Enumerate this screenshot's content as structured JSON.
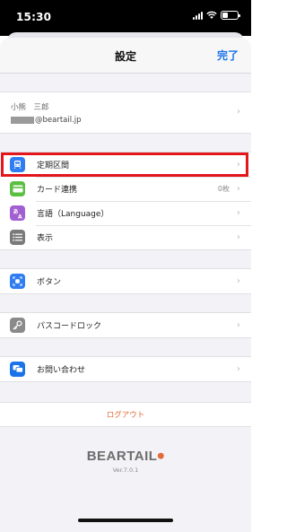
{
  "status_bar": {
    "time": "15:30",
    "battery_level": 0.35,
    "icons": [
      "signal-icon",
      "wifi-icon",
      "battery-icon"
    ]
  },
  "nav": {
    "title": "設定",
    "done_label": "完了"
  },
  "account": {
    "name": "小熊　三郎",
    "email_suffix": "@beartail.jp"
  },
  "menu": {
    "items": [
      {
        "label": "定期区間",
        "value": "",
        "icon": "train-icon",
        "color": "#2f7df0",
        "highlighted": true
      },
      {
        "label": "カード連携",
        "value": "0枚",
        "icon": "card-icon",
        "color": "#5bbf42",
        "highlighted": false
      },
      {
        "label": "言語（Language）",
        "value": "",
        "icon": "language-icon",
        "color": "#a25fd1",
        "highlighted": false
      },
      {
        "label": "表示",
        "value": "",
        "icon": "list-icon",
        "color": "#7a7a7a",
        "highlighted": false
      }
    ],
    "button_item": {
      "label": "ボタン",
      "icon": "button-icon",
      "color": "#2f7df0"
    },
    "passcode_item": {
      "label": "パスコードロック",
      "icon": "key-icon",
      "color": "#8a8a8a"
    },
    "contact_item": {
      "label": "お問い合わせ",
      "icon": "chat-icon",
      "color": "#1a73e8"
    }
  },
  "logout_label": "ログアウト",
  "brand": {
    "name": "BEARTAIL",
    "version": "Ver.7.0.1"
  },
  "colors": {
    "accent": "#1a73e8",
    "highlight_border": "#e3161b",
    "logout": "#e46a3a"
  }
}
